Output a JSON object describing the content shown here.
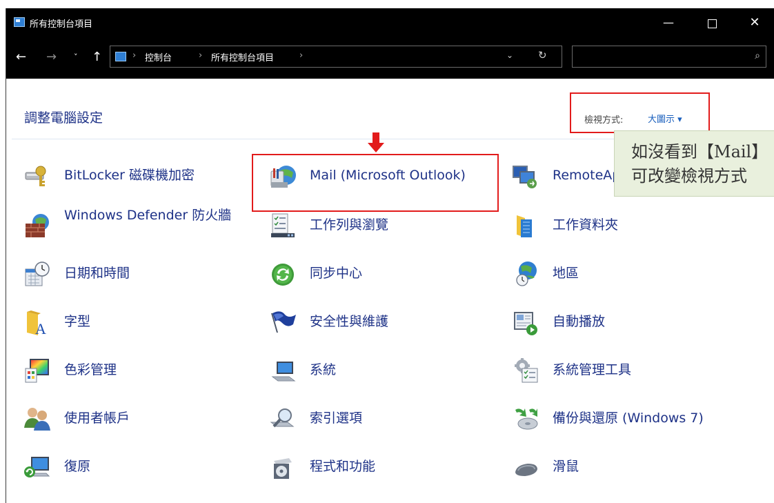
{
  "window": {
    "title": "所有控制台項目",
    "min_glyph": "—",
    "close_glyph": "✕"
  },
  "address": {
    "back": "←",
    "forward": "→",
    "recent": "˅",
    "up": "↑",
    "sep": "›",
    "crumbs": [
      "控制台",
      "所有控制台項目"
    ],
    "dropdown_glyph": "⌄",
    "refresh_glyph": "↻",
    "search_placeholder": "",
    "search_glyph": "⌕"
  },
  "main": {
    "title": "調整電腦設定",
    "view_by_label": "檢視方式:",
    "view_by_value": "大圖示 ▾"
  },
  "tooltip": {
    "line1": "如沒看到【Mail】",
    "line2": "可改變檢視方式"
  },
  "items": [
    {
      "label": "BitLocker 磁碟機加密",
      "icon": "bitlocker-icon"
    },
    {
      "label": "Mail (Microsoft Outlook)",
      "icon": "mail-icon"
    },
    {
      "label": "RemoteApp",
      "icon": "remoteapp-icon"
    },
    {
      "label": "Windows Defender 防火牆",
      "icon": "firewall-icon"
    },
    {
      "label": "工作列與瀏覽",
      "icon": "taskbar-icon"
    },
    {
      "label": "工作資料夾",
      "icon": "work-folders-icon"
    },
    {
      "label": "日期和時間",
      "icon": "date-time-icon"
    },
    {
      "label": "同步中心",
      "icon": "sync-center-icon"
    },
    {
      "label": "地區",
      "icon": "region-icon"
    },
    {
      "label": "字型",
      "icon": "fonts-icon"
    },
    {
      "label": "安全性與維護",
      "icon": "security-flag-icon"
    },
    {
      "label": "自動播放",
      "icon": "autoplay-icon"
    },
    {
      "label": "色彩管理",
      "icon": "color-management-icon"
    },
    {
      "label": "系統",
      "icon": "system-icon"
    },
    {
      "label": "系統管理工具",
      "icon": "admin-tools-icon"
    },
    {
      "label": "使用者帳戶",
      "icon": "user-accounts-icon"
    },
    {
      "label": "索引選項",
      "icon": "indexing-icon"
    },
    {
      "label": "備份與還原 (Windows 7)",
      "icon": "backup-restore-icon"
    },
    {
      "label": "復原",
      "icon": "recovery-icon"
    },
    {
      "label": "程式和功能",
      "icon": "programs-icon"
    },
    {
      "label": "滑鼠",
      "icon": "mouse-icon"
    }
  ]
}
